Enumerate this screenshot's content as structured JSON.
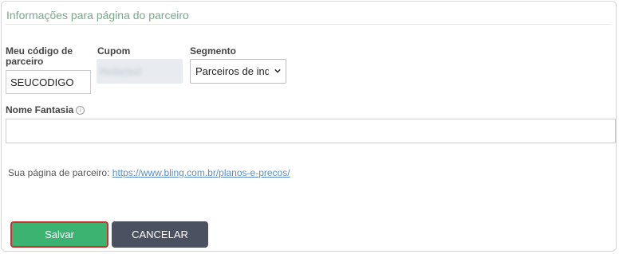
{
  "section": {
    "title": "Informações para página do parceiro"
  },
  "fields": {
    "code_label": "Meu código de parceiro",
    "code_value": "SEUCODIGO",
    "cupom_label": "Cupom",
    "cupom_value": "Redacted",
    "segment_label": "Segmento",
    "segment_selected": "Parceiros de indicação",
    "name_label": "Nome Fantasia",
    "name_value": ""
  },
  "partner_page": {
    "prefix": "Sua página de parceiro:",
    "link": "https://www.bling.com.br/planos-e-precos/"
  },
  "buttons": {
    "save": "Salvar",
    "cancel": "CANCELAR"
  },
  "colors": {
    "title": "#7aa88a",
    "save_bg": "#3cb371",
    "save_border": "#cf2e2e",
    "cancel_bg": "#4a5160",
    "link": "#5a8fc4"
  },
  "icons": {
    "info": "info-circle-icon",
    "dropdown": "chevron-down-icon"
  }
}
